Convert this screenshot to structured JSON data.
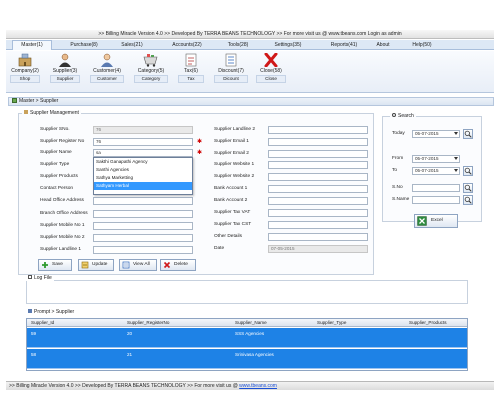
{
  "title_bar": ">> Billing Miracle Version 4.0  >> Developed By TERRA BEANS TECHNOLOGY  >> For more visit us @ www.tbeans.com      Login as admin",
  "menu": [
    "Master(1)",
    "Purchase(8)",
    "Sales(21)",
    "Accounts(22)",
    "Tools(28)",
    "Settings(35)",
    "Reports(41)",
    "About",
    "Help(50)"
  ],
  "toolbar": [
    {
      "label": "Company(2)",
      "sub": "Shop",
      "icon": "company-icon"
    },
    {
      "label": "Supplier(3)",
      "sub": "Supplier",
      "icon": "supplier-icon"
    },
    {
      "label": "Customer(4)",
      "sub": "Customer",
      "icon": "customer-icon"
    },
    {
      "label": "Category(5)",
      "sub": "Category",
      "icon": "category-icon"
    },
    {
      "label": "Tax(6)",
      "sub": "Tax",
      "icon": "tax-icon"
    },
    {
      "label": "Discount(7)",
      "sub": "Dicount",
      "icon": "discount-icon"
    },
    {
      "label": "Close(58)",
      "sub": "Close",
      "icon": "close-icon"
    }
  ],
  "breadcrumb": "Master > Supplier",
  "supplier_mgmt": {
    "header": "Supplier Management",
    "left_fields": [
      {
        "label": "Supplier SNo.",
        "value": "76"
      },
      {
        "label": "Supplier Register No",
        "value": "76"
      },
      {
        "label": "Supplier Name",
        "value": "sa"
      },
      {
        "label": "Supplier Type",
        "value": ""
      },
      {
        "label": "Supplier Products",
        "value": ""
      },
      {
        "label": "Contact Person",
        "value": ""
      },
      {
        "label": "Head Office Address",
        "value": ""
      },
      {
        "label": "Branch Office Address",
        "value": ""
      },
      {
        "label": "Supplier Mobile No 1",
        "value": ""
      },
      {
        "label": "Supplier Mobile No 2",
        "value": ""
      },
      {
        "label": "Supplier Landline 1",
        "value": ""
      }
    ],
    "right_fields": [
      {
        "label": "Supplier Landline 2",
        "value": ""
      },
      {
        "label": "Supplier Email 1",
        "value": ""
      },
      {
        "label": "Supplier Email 2",
        "value": ""
      },
      {
        "label": "Supplier Website 1",
        "value": ""
      },
      {
        "label": "Supplier Website 2",
        "value": ""
      },
      {
        "label": "Bank Account 1",
        "value": ""
      },
      {
        "label": "Bank Account 2",
        "value": ""
      },
      {
        "label": "Supplier Tax VAT",
        "value": ""
      },
      {
        "label": "Supplier Tax CST",
        "value": ""
      },
      {
        "label": "Other Details",
        "value": ""
      },
      {
        "label": "Date",
        "value": "07-05-2015"
      }
    ],
    "suggestions": [
      "Sakthi Ganapathi Agency",
      "Santhi Agencies",
      "Sathya Marketting",
      "Sathyam Herbal"
    ],
    "selected_suggestion": 3,
    "buttons": {
      "save": "Save",
      "update": "Update",
      "view_all": "View All",
      "delete": "Delete"
    }
  },
  "search": {
    "header": "Search",
    "today_label": "Today",
    "today_value": "05-07-2015",
    "from_label": "From",
    "from_value": "05-07-2015",
    "to_label": "To",
    "to_value": "05-07-2015",
    "sno_label": "S.No",
    "sname_label": "S.Name",
    "excel_label": "Excel"
  },
  "log_file": {
    "header": "Log File"
  },
  "prompt": {
    "header": "Prompt > Supplier",
    "columns": [
      "Supplier_Id",
      "Supplier_RegisterNo",
      "Supplier_Name",
      "Supplier_Type",
      "Supplier_Products"
    ],
    "rows": [
      [
        "59",
        "20",
        "SSS Agencies",
        "",
        ""
      ],
      [
        "58",
        "21",
        "Srinivasa Agencies",
        "",
        ""
      ]
    ]
  },
  "status_bar": {
    "text": ">> Billing Miracle Version 4.0  >> Developed By TERRA BEANS TECHNOLOGY  >> For more visit us @ ",
    "link": "www.tbeans.com"
  },
  "colors": {
    "accent": "#1e82e6",
    "menubar": "#dde8f5",
    "required": "#d00000"
  }
}
